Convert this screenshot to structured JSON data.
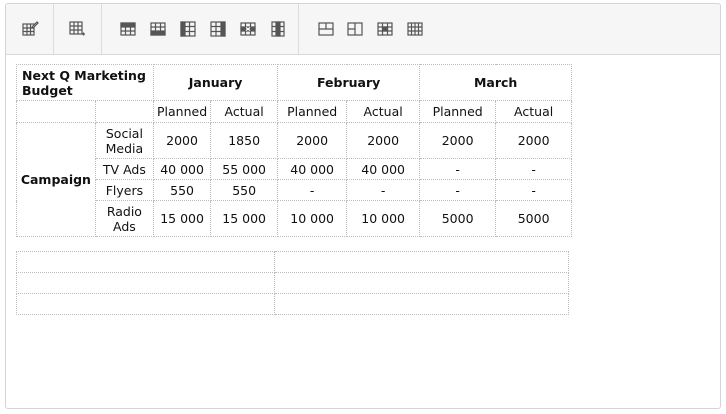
{
  "toolbar": {
    "groups": [
      {
        "items": [
          "edit-table-icon"
        ]
      },
      {
        "items": [
          "insert-table-icon"
        ]
      },
      {
        "items": [
          "insert-row-above-icon",
          "insert-row-below-icon",
          "insert-column-left-icon",
          "insert-column-right-icon",
          "delete-row-icon",
          "delete-column-icon"
        ]
      },
      {
        "items": [
          "merge-cells-icon",
          "split-cells-icon",
          "table-header-icon",
          "table-properties-icon"
        ]
      }
    ]
  },
  "budget_table": {
    "title": "Next Q Marketing Budget",
    "months": [
      "January",
      "February",
      "March"
    ],
    "subheaders": [
      "Planned",
      "Actual",
      "Planned",
      "Actual",
      "Planned",
      "Actual"
    ],
    "row_group": "Campaign",
    "rows": [
      {
        "label": "Social Media",
        "values": [
          "2000",
          "1850",
          "2000",
          "2000",
          "2000",
          "2000"
        ]
      },
      {
        "label": "TV Ads",
        "values": [
          "40 000",
          "55 000",
          "40 000",
          "40 000",
          "-",
          "-"
        ]
      },
      {
        "label": "Flyers",
        "values": [
          "550",
          "550",
          "-",
          "-",
          "-",
          "-"
        ]
      },
      {
        "label": "Radio Ads",
        "values": [
          "15 000",
          "15 000",
          "10 000",
          "10 000",
          "5000",
          "5000"
        ]
      }
    ]
  }
}
